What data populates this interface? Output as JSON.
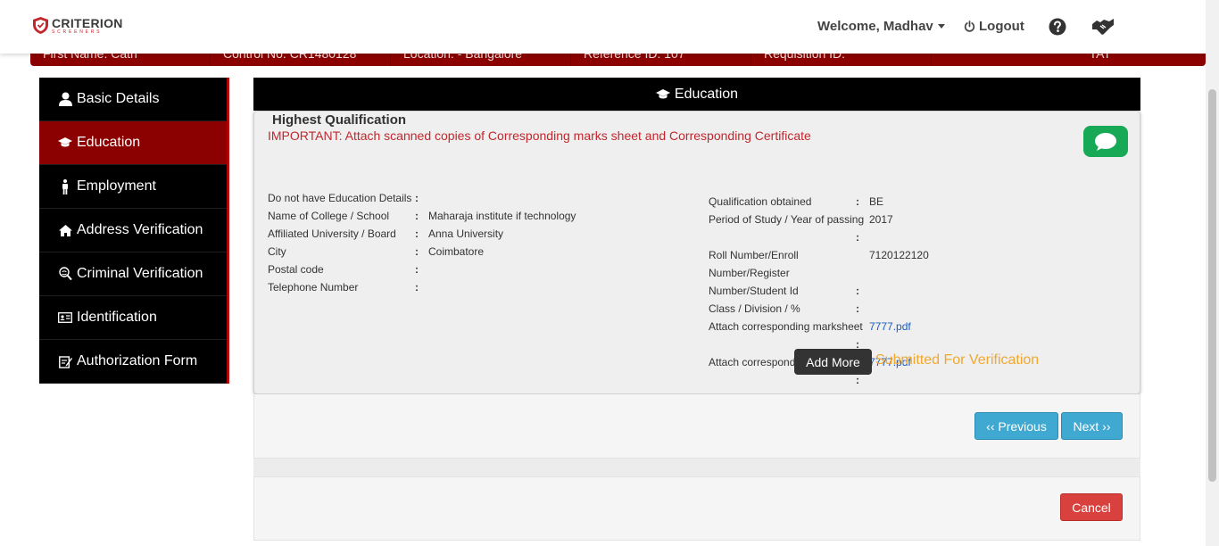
{
  "header": {
    "brand": "CRITERION",
    "brand_sub": "SCREENERS",
    "welcome": "Welcome, Madhav",
    "logout": "Logout"
  },
  "infobar": {
    "cells": [
      "First Name: Cath",
      "Control No: CR1480128",
      "Location: - Bangalore",
      "Reference ID: 107",
      "Requisition ID:"
    ],
    "last": "TAT"
  },
  "sidebar": {
    "items": [
      {
        "label": "Basic Details",
        "icon": "user-icon"
      },
      {
        "label": "Education",
        "icon": "graduation-cap-icon"
      },
      {
        "label": "Employment",
        "icon": "male-icon"
      },
      {
        "label": "Address Verification",
        "icon": "home-icon"
      },
      {
        "label": "Criminal Verification",
        "icon": "fingerprint-search-icon"
      },
      {
        "label": "Identification",
        "icon": "id-card-icon"
      },
      {
        "label": "Authorization Form",
        "icon": "edit-form-icon"
      }
    ],
    "active": "Education"
  },
  "main": {
    "title": "Education",
    "panel": {
      "heading": "Highest Qualification",
      "important": "IMPORTANT: Attach scanned copies of Corresponding marks sheet and Corresponding Certificate",
      "left_fields": [
        {
          "label": "Do not have Education Details",
          "value": ""
        },
        {
          "label": "Name of College / School",
          "value": "Maharaja institute if technology"
        },
        {
          "label": "Affiliated University / Board",
          "value": "Anna University"
        },
        {
          "label": "City",
          "value": "Coimbatore"
        },
        {
          "label": "Postal code",
          "value": ""
        },
        {
          "label": "Telephone Number",
          "value": ""
        }
      ],
      "right_fields": {
        "qualification_label": "Qualification obtained",
        "qualification_value": "BE",
        "period_label": "Period of Study / Year of passing",
        "period_value": "2017",
        "roll_label_1": "Roll Number/Enroll",
        "roll_label_2": "Number/Register",
        "roll_label_3": "Number/Student Id",
        "roll_value": "7120122120",
        "class_label": "Class / Division / %",
        "class_value": "",
        "marksheet_label": "Attach corresponding marksheet",
        "marksheet_value": "7777.pdf",
        "certificate_label": "Attach corresponding certificate",
        "certificate_value": "7777.pdf"
      },
      "add_more": "Add More",
      "status": "Submitted For Verification"
    },
    "previous": "‹‹ Previous",
    "next": "Next ››",
    "cancel": "Cancel"
  },
  "colors": {
    "brand_red": "#8b0000",
    "status_orange": "#f0a830",
    "chat_green": "#17a955",
    "link_blue": "#1a5bbf"
  }
}
